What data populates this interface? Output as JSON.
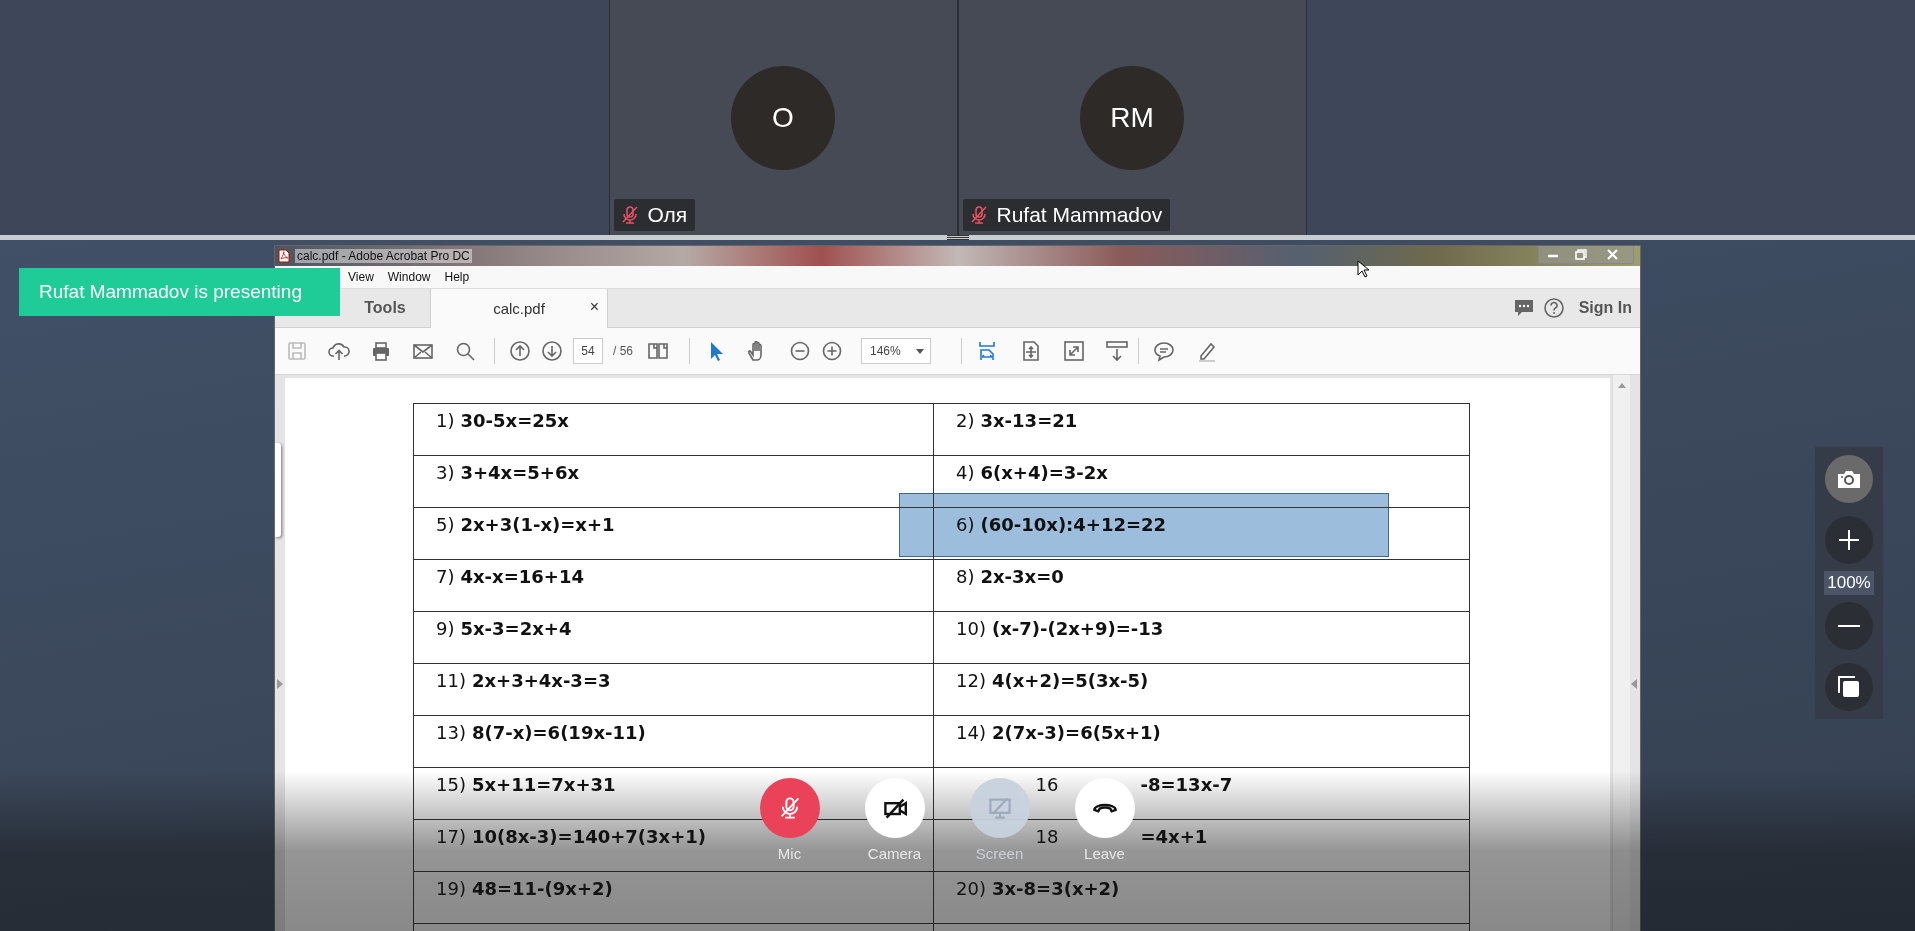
{
  "participants": [
    {
      "initials": "O",
      "name": "Оля",
      "muted": true
    },
    {
      "initials": "RM",
      "name": "Rufat Mammadov",
      "muted": true
    }
  ],
  "presenter_banner": "Rufat Mammadov is presenting",
  "acrobat": {
    "title": "calc.pdf - Adobe Acrobat Pro DC",
    "menu": [
      "View",
      "Window",
      "Help"
    ],
    "tabs": [
      {
        "label": "Tools",
        "selected": false
      },
      {
        "label": "calc.pdf",
        "selected": true,
        "close": "×"
      }
    ],
    "sign_in": "Sign In",
    "page": {
      "current": "54",
      "total": "/ 56"
    },
    "zoom": "146%",
    "rows": [
      {
        "left": {
          "number": "1)",
          "equation": "30-5x=25x",
          "highlighted": false
        },
        "right": {
          "number": "2)",
          "equation": "3x-13=21",
          "highlighted": false
        }
      },
      {
        "left": {
          "number": "3)",
          "equation": "3+4x=5+6x",
          "highlighted": false
        },
        "right": {
          "number": "4)",
          "equation": "6(x+4)=3-2x",
          "highlighted": false
        }
      },
      {
        "left": {
          "number": "5)",
          "equation": "2x+3(1-x)=x+1",
          "highlighted": false
        },
        "right": {
          "number": "6)",
          "equation": "(60-10x):4+12=22",
          "highlighted": true
        }
      },
      {
        "left": {
          "number": "7)",
          "equation": "4x-x=16+14",
          "highlighted": false
        },
        "right": {
          "number": "8)",
          "equation": "2x-3x=0",
          "highlighted": false
        }
      },
      {
        "left": {
          "number": "9)",
          "equation": "5x-3=2x+4",
          "highlighted": false
        },
        "right": {
          "number": "10)",
          "equation": "(x-7)-(2x+9)=-13",
          "highlighted": false
        }
      },
      {
        "left": {
          "number": "11)",
          "equation": "2x+3+4x-3=3",
          "highlighted": false
        },
        "right": {
          "number": "12)",
          "equation": "4(x+2)=5(3x-5)",
          "highlighted": false
        }
      },
      {
        "left": {
          "number": "13)",
          "equation": "8(7-x)=6(19x-11)",
          "highlighted": false
        },
        "right": {
          "number": "14)",
          "equation": "2(7x-3)=6(5x+1)",
          "highlighted": false
        }
      },
      {
        "left": {
          "number": "15)",
          "equation": "5x+11=7x+31",
          "highlighted": false
        },
        "right": {
          "number": "16",
          "parts": [
            "-8=13x-7"
          ],
          "highlighted": false
        }
      },
      {
        "left": {
          "number": "17)",
          "equation": "10(8x-3)=140+7(3x+1)",
          "highlighted": false
        },
        "right": {
          "number": "18",
          "parts": [
            "=4x+1"
          ],
          "highlighted": false
        }
      },
      {
        "left": {
          "number": "19)",
          "equation": "48=11-(9x+2)",
          "highlighted": false
        },
        "right": {
          "number": "20)",
          "equation": "3x-8=3(x+2)",
          "highlighted": false
        }
      }
    ]
  },
  "call_controls": [
    {
      "kind": "mic",
      "label": "Mic",
      "on": false,
      "disabled": false
    },
    {
      "kind": "camera",
      "label": "Camera",
      "on": false,
      "disabled": false
    },
    {
      "kind": "screen",
      "label": "Screen",
      "on": false,
      "disabled": true
    },
    {
      "kind": "leave",
      "label": "Leave",
      "disabled": false
    }
  ],
  "zoom_panel": {
    "level": "100%"
  }
}
